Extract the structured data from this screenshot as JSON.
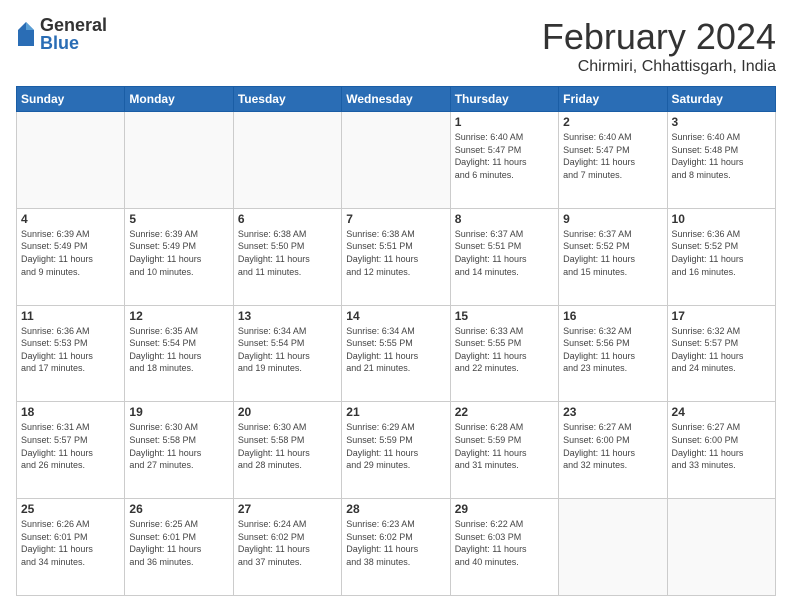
{
  "header": {
    "logo": {
      "general": "General",
      "blue": "Blue"
    },
    "month": "February 2024",
    "location": "Chirmiri, Chhattisgarh, India"
  },
  "days_of_week": [
    "Sunday",
    "Monday",
    "Tuesday",
    "Wednesday",
    "Thursday",
    "Friday",
    "Saturday"
  ],
  "weeks": [
    [
      {
        "day": "",
        "info": ""
      },
      {
        "day": "",
        "info": ""
      },
      {
        "day": "",
        "info": ""
      },
      {
        "day": "",
        "info": ""
      },
      {
        "day": "1",
        "info": "Sunrise: 6:40 AM\nSunset: 5:47 PM\nDaylight: 11 hours\nand 6 minutes."
      },
      {
        "day": "2",
        "info": "Sunrise: 6:40 AM\nSunset: 5:47 PM\nDaylight: 11 hours\nand 7 minutes."
      },
      {
        "day": "3",
        "info": "Sunrise: 6:40 AM\nSunset: 5:48 PM\nDaylight: 11 hours\nand 8 minutes."
      }
    ],
    [
      {
        "day": "4",
        "info": "Sunrise: 6:39 AM\nSunset: 5:49 PM\nDaylight: 11 hours\nand 9 minutes."
      },
      {
        "day": "5",
        "info": "Sunrise: 6:39 AM\nSunset: 5:49 PM\nDaylight: 11 hours\nand 10 minutes."
      },
      {
        "day": "6",
        "info": "Sunrise: 6:38 AM\nSunset: 5:50 PM\nDaylight: 11 hours\nand 11 minutes."
      },
      {
        "day": "7",
        "info": "Sunrise: 6:38 AM\nSunset: 5:51 PM\nDaylight: 11 hours\nand 12 minutes."
      },
      {
        "day": "8",
        "info": "Sunrise: 6:37 AM\nSunset: 5:51 PM\nDaylight: 11 hours\nand 14 minutes."
      },
      {
        "day": "9",
        "info": "Sunrise: 6:37 AM\nSunset: 5:52 PM\nDaylight: 11 hours\nand 15 minutes."
      },
      {
        "day": "10",
        "info": "Sunrise: 6:36 AM\nSunset: 5:52 PM\nDaylight: 11 hours\nand 16 minutes."
      }
    ],
    [
      {
        "day": "11",
        "info": "Sunrise: 6:36 AM\nSunset: 5:53 PM\nDaylight: 11 hours\nand 17 minutes."
      },
      {
        "day": "12",
        "info": "Sunrise: 6:35 AM\nSunset: 5:54 PM\nDaylight: 11 hours\nand 18 minutes."
      },
      {
        "day": "13",
        "info": "Sunrise: 6:34 AM\nSunset: 5:54 PM\nDaylight: 11 hours\nand 19 minutes."
      },
      {
        "day": "14",
        "info": "Sunrise: 6:34 AM\nSunset: 5:55 PM\nDaylight: 11 hours\nand 21 minutes."
      },
      {
        "day": "15",
        "info": "Sunrise: 6:33 AM\nSunset: 5:55 PM\nDaylight: 11 hours\nand 22 minutes."
      },
      {
        "day": "16",
        "info": "Sunrise: 6:32 AM\nSunset: 5:56 PM\nDaylight: 11 hours\nand 23 minutes."
      },
      {
        "day": "17",
        "info": "Sunrise: 6:32 AM\nSunset: 5:57 PM\nDaylight: 11 hours\nand 24 minutes."
      }
    ],
    [
      {
        "day": "18",
        "info": "Sunrise: 6:31 AM\nSunset: 5:57 PM\nDaylight: 11 hours\nand 26 minutes."
      },
      {
        "day": "19",
        "info": "Sunrise: 6:30 AM\nSunset: 5:58 PM\nDaylight: 11 hours\nand 27 minutes."
      },
      {
        "day": "20",
        "info": "Sunrise: 6:30 AM\nSunset: 5:58 PM\nDaylight: 11 hours\nand 28 minutes."
      },
      {
        "day": "21",
        "info": "Sunrise: 6:29 AM\nSunset: 5:59 PM\nDaylight: 11 hours\nand 29 minutes."
      },
      {
        "day": "22",
        "info": "Sunrise: 6:28 AM\nSunset: 5:59 PM\nDaylight: 11 hours\nand 31 minutes."
      },
      {
        "day": "23",
        "info": "Sunrise: 6:27 AM\nSunset: 6:00 PM\nDaylight: 11 hours\nand 32 minutes."
      },
      {
        "day": "24",
        "info": "Sunrise: 6:27 AM\nSunset: 6:00 PM\nDaylight: 11 hours\nand 33 minutes."
      }
    ],
    [
      {
        "day": "25",
        "info": "Sunrise: 6:26 AM\nSunset: 6:01 PM\nDaylight: 11 hours\nand 34 minutes."
      },
      {
        "day": "26",
        "info": "Sunrise: 6:25 AM\nSunset: 6:01 PM\nDaylight: 11 hours\nand 36 minutes."
      },
      {
        "day": "27",
        "info": "Sunrise: 6:24 AM\nSunset: 6:02 PM\nDaylight: 11 hours\nand 37 minutes."
      },
      {
        "day": "28",
        "info": "Sunrise: 6:23 AM\nSunset: 6:02 PM\nDaylight: 11 hours\nand 38 minutes."
      },
      {
        "day": "29",
        "info": "Sunrise: 6:22 AM\nSunset: 6:03 PM\nDaylight: 11 hours\nand 40 minutes."
      },
      {
        "day": "",
        "info": ""
      },
      {
        "day": "",
        "info": ""
      }
    ]
  ]
}
